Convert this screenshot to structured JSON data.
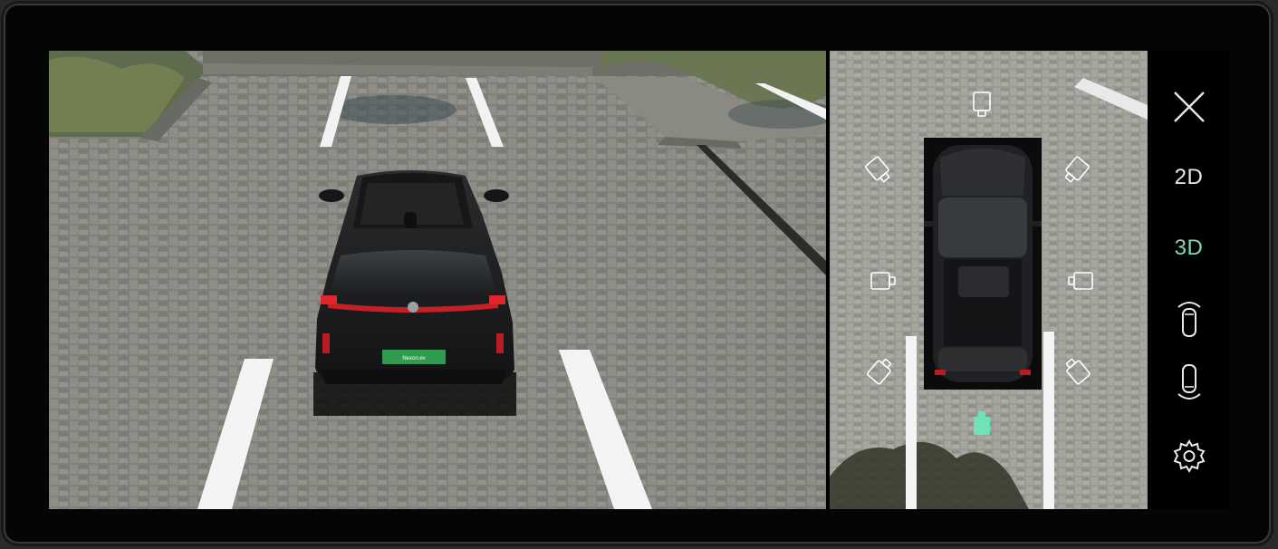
{
  "sidebar": {
    "close_icon": "close-icon",
    "mode_2d_label": "2D",
    "mode_3d_label": "3D",
    "active_mode": "3D",
    "front_view_icon": "car-front-view-icon",
    "rear_view_icon": "car-rear-view-icon",
    "settings_icon": "gear-icon"
  },
  "main_view": {
    "plate_text": "Nexon.ev"
  },
  "top_view": {
    "cameras": [
      {
        "name": "front",
        "icon": "camera-icon"
      },
      {
        "name": "front-left",
        "icon": "camera-icon"
      },
      {
        "name": "front-right",
        "icon": "camera-icon"
      },
      {
        "name": "left",
        "icon": "camera-icon"
      },
      {
        "name": "right",
        "icon": "camera-icon"
      },
      {
        "name": "rear-left",
        "icon": "camera-icon"
      },
      {
        "name": "rear-right",
        "icon": "camera-icon"
      },
      {
        "name": "rear",
        "icon": "camera-icon",
        "selected": true
      }
    ]
  },
  "colors": {
    "accent": "#7ed9c0",
    "icon": "#e8e8e8",
    "selected_camera": "#6fe3b8"
  }
}
